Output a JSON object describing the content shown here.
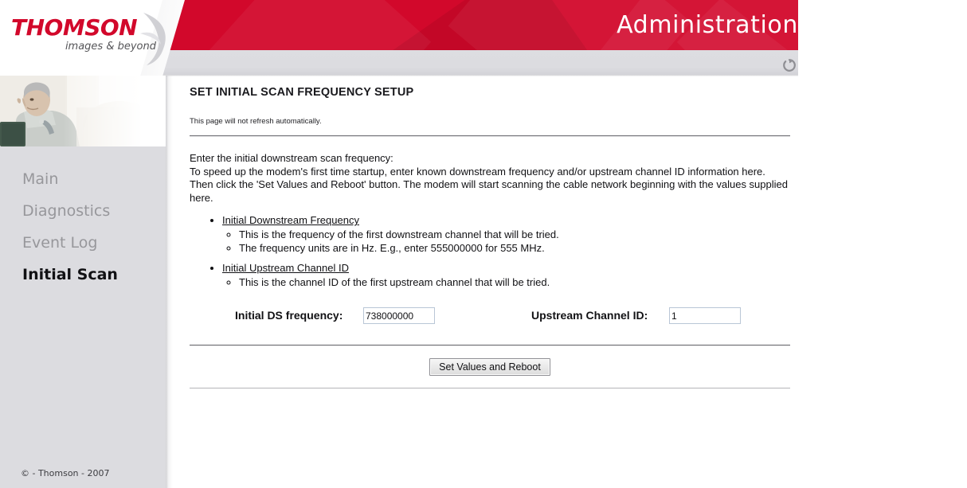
{
  "header": {
    "title": "Administration",
    "logo": {
      "brand": "THOMSON",
      "tagline": "images & beyond"
    },
    "refresh_icon": "refresh-spinner-icon",
    "band_color": "#D2082B"
  },
  "sidebar": {
    "photo_alt": "man-sitting-with-tablet-photo",
    "items": [
      {
        "label": "Main",
        "active": false
      },
      {
        "label": "Diagnostics",
        "active": false
      },
      {
        "label": "Event Log",
        "active": false
      },
      {
        "label": "Initial Scan",
        "active": true
      }
    ],
    "copyright": "© - Thomson - 2007"
  },
  "main": {
    "page_title": "SET INITIAL SCAN FREQUENCY SETUP",
    "refresh_note": "This page will not refresh automatically.",
    "intro_line_1": "Enter the initial downstream scan frequency:",
    "intro_line_2": "To speed up the modem's first time startup, enter known downstream frequency and/or upstream channel ID information here.",
    "intro_line_3": "Then click the 'Set Values and Reboot' button. The modem will start scanning the cable network beginning with the values supplied",
    "intro_line_4": "here.",
    "bullets": [
      {
        "label": "Initial Downstream Frequency",
        "sub": [
          "This is the frequency of the first downstream channel that will be tried.",
          "The frequency units are in Hz. E.g., enter 555000000 for 555 MHz."
        ]
      },
      {
        "label": "Initial Upstream Channel ID",
        "sub": [
          "This is the channel ID of the first upstream channel that will be tried."
        ]
      }
    ],
    "form": {
      "ds_frequency_label": "Initial DS frequency:",
      "ds_frequency_value": "738000000",
      "upstream_channel_label": "Upstream Channel ID:",
      "upstream_channel_value": "1"
    },
    "submit_label": "Set Values and Reboot"
  }
}
